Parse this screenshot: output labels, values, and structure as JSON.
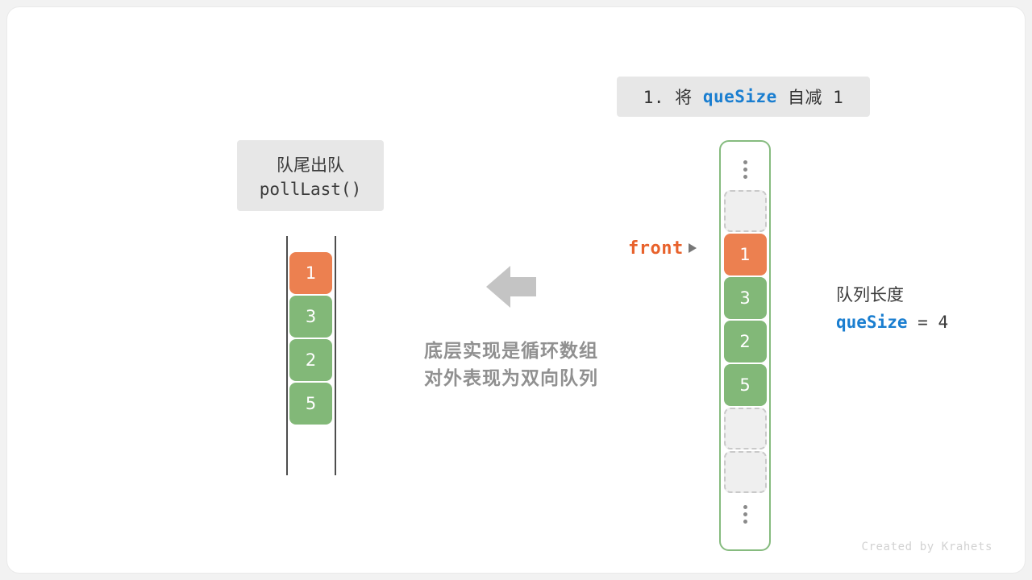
{
  "figure": {
    "title_chip": {
      "prefix": "1. 将 ",
      "keyword": "queSize",
      "suffix": " 自减 1"
    },
    "operation_box": {
      "line1": "队尾出队",
      "line2": "pollLast()"
    },
    "center_caption": {
      "line1": "底层实现是循环数组",
      "line2": "对外表现为双向队列"
    },
    "arrow_icon": "left-arrow-icon",
    "left_array": {
      "name": "linear-deque-view",
      "cells": [
        {
          "value": "1",
          "color": "orange"
        },
        {
          "value": "3",
          "color": "green"
        },
        {
          "value": "2",
          "color": "green"
        },
        {
          "value": "5",
          "color": "green"
        }
      ]
    },
    "right_array": {
      "name": "circular-array-view",
      "top_ellipsis": "⋮",
      "bottom_ellipsis": "⋮",
      "cells": [
        {
          "value": "",
          "color": "empty"
        },
        {
          "value": "1",
          "color": "orange"
        },
        {
          "value": "3",
          "color": "green"
        },
        {
          "value": "2",
          "color": "green"
        },
        {
          "value": "5",
          "color": "green"
        },
        {
          "value": "",
          "color": "empty"
        },
        {
          "value": "",
          "color": "empty"
        }
      ]
    },
    "front_pointer": {
      "label": "front",
      "arrow_icon": "right-arrowhead-icon"
    },
    "size_info": {
      "label": "队列长度",
      "keyword": "queSize",
      "expression": " = 4"
    },
    "credit": "Created by Krahets",
    "colors": {
      "orange": "#ec8050",
      "green": "#82b878",
      "empty_fill": "#efefef",
      "empty_border": "#c9c9c9",
      "container_border": "#86bb7f",
      "chip_bg": "#e7e7e7",
      "keyword_blue": "#1a7ed0",
      "front_orange": "#e8622c",
      "caption_gray": "#909090",
      "arrow_gray": "#c4c4c4"
    }
  }
}
